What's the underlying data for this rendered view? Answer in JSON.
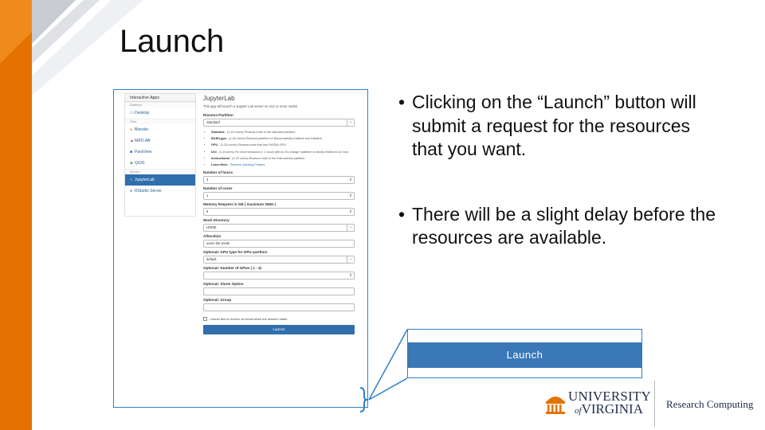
{
  "slide": {
    "title": "Launch",
    "accent_color": "#e57200",
    "bullets": [
      "Clicking on the “Launch” button will submit a request for the resources that you want.",
      "There will be a slight delay before the resources are available."
    ],
    "callout_button_label": "Launch"
  },
  "screenshot": {
    "menu": {
      "header": "Interactive Apps",
      "categories": [
        "Desktops",
        "GUIs",
        "Servers"
      ],
      "items": [
        "Desktop",
        "Blender",
        "MATLAB",
        "ParaView",
        "QGIS",
        "JupyterLab",
        "RStudio Server"
      ],
      "active_item": "JupyterLab"
    },
    "form": {
      "title": "JupyterLab",
      "description": "This app will launch a Jupyter Lab server on one or more nodes.",
      "partition_label": "Rivanna Partition",
      "partition_value": "Standard",
      "partition_notes": [
        {
          "name": "Standard",
          "text": " - (1-40 cores) Rivanna node in the standard partition."
        },
        {
          "name": "BII,Bii-gpu",
          "text": " - (1-40 cores) Rivanna partition for Biocomplexity Institute and Initiative."
        },
        {
          "name": "GPU",
          "text": " - (1-28 cores) Rivanna node that has NVIDIA GPU."
        },
        {
          "name": "Dev",
          "text": " - (1-8 cores) For short sessions (< 1 hour) with no SU charge; walltime is strictly limited to an hour."
        },
        {
          "name": "Instructional",
          "text": " - (1-20 cores) Rivanna node in the instructional partition."
        }
      ],
      "learn_more_label": "Learn More",
      "learn_more_link": "Rivanna Queuing Policies",
      "hours_label": "Number of hours",
      "hours_value": "3",
      "cores_label": "Number of cores",
      "cores_value": "1",
      "memory_label": "Memory Request in GB ( maximum 256G )",
      "memory_value": "6",
      "workdir_label": "Work Directory",
      "workdir_value": "HOME",
      "allocation_label": "Allocation",
      "allocation_value": "uvarc-dsr-meds",
      "gpu_type_label": "Optional: GPU type for GPU partition",
      "gpu_type_value": "default",
      "gpu_count_label": "Optional: Number of GPUs ( 1 - 4)",
      "slurm_label": "Optional: Slurm Option",
      "group_label": "Optional: Group",
      "email_label": "I would like to receive an email when the session starts",
      "launch_label": "Launch"
    }
  },
  "logos": {
    "uva_line1": "UNIVERSITY",
    "uva_line2": "VIRGINIA",
    "uva_of": "of",
    "research_computing": "Research Computing",
    "uva_navy": "#232d4b",
    "uva_orange": "#e57200"
  }
}
